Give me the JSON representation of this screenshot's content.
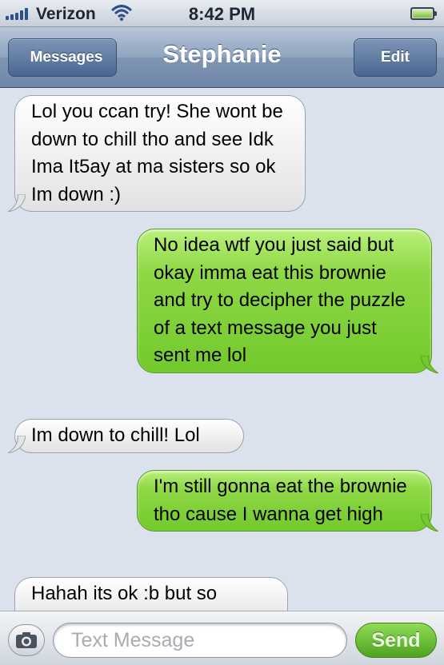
{
  "status_bar": {
    "carrier": "Verizon",
    "time": "8:42 PM",
    "signal_bars": 5,
    "battery_level": 1.0
  },
  "nav": {
    "back_label": "Messages",
    "title": "Stephanie",
    "edit_label": "Edit"
  },
  "messages": [
    {
      "direction": "incoming",
      "text": "Lol you ccan try! She wont be down to chill tho and see Idk Ima It5ay at ma sisters so ok Im down :)"
    },
    {
      "direction": "outgoing",
      "text": "No idea wtf you just said but okay imma eat this brownie and try to decipher the puzzle of a text message you just sent me lol"
    },
    {
      "direction": "incoming",
      "text": "Im down to chill! Lol"
    },
    {
      "direction": "outgoing",
      "text": "I'm still gonna eat the brownie tho cause I wanna get high"
    },
    {
      "direction": "incoming",
      "text": "Hahah its ok :b but so"
    }
  ],
  "input": {
    "placeholder": "Text Message",
    "send_label": "Send"
  },
  "colors": {
    "incoming_bubble": "#f2f2f2",
    "outgoing_bubble": "#82d23a",
    "nav_bar": "#8ea3bf"
  },
  "icons": [
    "signal-icon",
    "wifi-icon",
    "battery-icon",
    "back-arrow-icon",
    "camera-icon"
  ]
}
